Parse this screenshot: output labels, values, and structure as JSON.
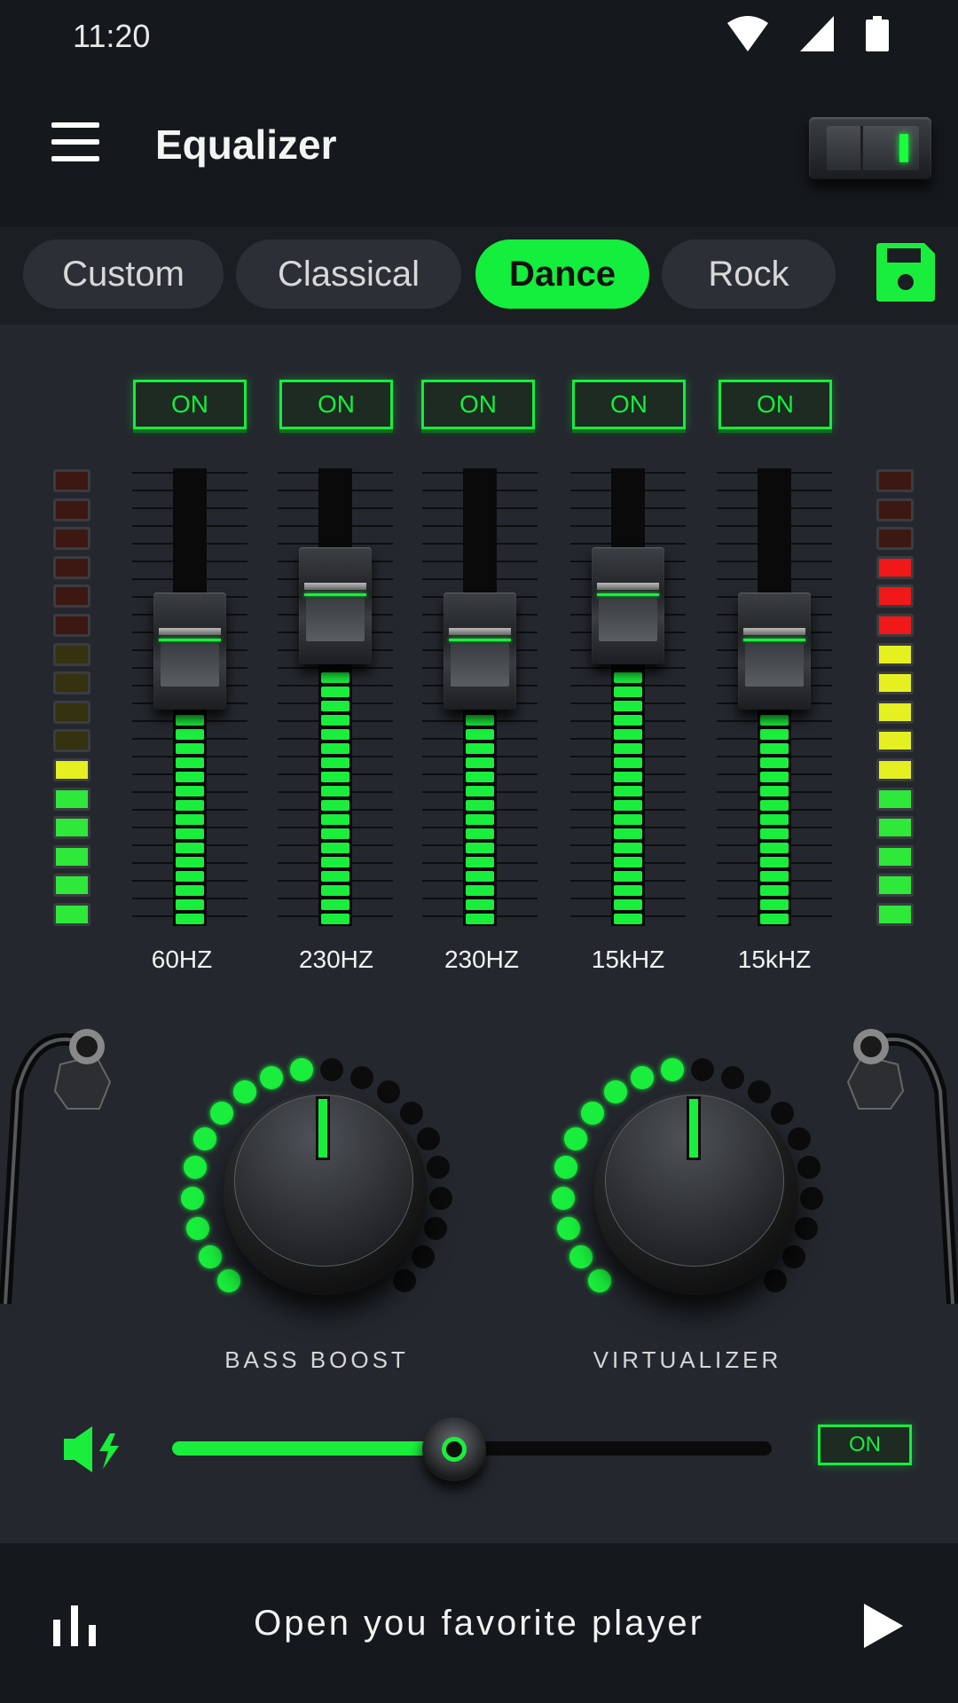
{
  "status": {
    "time": "11:20"
  },
  "app": {
    "title": "Equalizer",
    "power_on": true
  },
  "presets": {
    "tabs": [
      "Custom",
      "Classical",
      "Dance",
      "Rock"
    ],
    "active": "Dance"
  },
  "bands": [
    {
      "toggle": "ON",
      "freq": "60HZ",
      "level": 0.6
    },
    {
      "toggle": "ON",
      "freq": "230HZ",
      "level": 0.7
    },
    {
      "toggle": "ON",
      "freq": "230HZ",
      "level": 0.6
    },
    {
      "toggle": "ON",
      "freq": "15kHZ",
      "level": 0.7
    },
    {
      "toggle": "ON",
      "freq": "15kHZ",
      "level": 0.6
    }
  ],
  "knobs": [
    {
      "label": "BASS BOOST",
      "level": 0.5
    },
    {
      "label": "VIRTUALIZER",
      "level": 0.5
    }
  ],
  "volume": {
    "level": 0.47,
    "toggle": "ON"
  },
  "player": {
    "text": "Open you favorite player"
  },
  "icons": [
    "menu-icon",
    "wifi-icon",
    "signal-icon",
    "battery-icon",
    "save-icon",
    "speaker-boost-icon",
    "equalizer-bars-icon",
    "play-icon"
  ],
  "colors": {
    "accent": "#19ee3c",
    "background": "#24282e",
    "bar": "#15181c"
  }
}
